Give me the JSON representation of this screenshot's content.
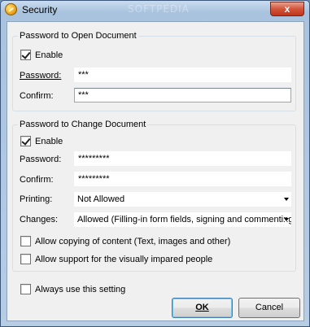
{
  "window": {
    "title": "Security",
    "watermark": "SOFTPEDIA",
    "close_label": "x"
  },
  "open_group": {
    "legend": "Password to Open Document",
    "enable_label": "Enable",
    "enable_checked": true,
    "password_label": "Password:",
    "password_value": "***",
    "confirm_label": "Confirm:",
    "confirm_value": "***"
  },
  "change_group": {
    "legend": "Password to Change Document",
    "enable_label": "Enable",
    "enable_checked": true,
    "password_label": "Password:",
    "password_value": "*********",
    "confirm_label": "Confirm:",
    "confirm_value": "*********",
    "printing_label": "Printing:",
    "printing_value": "Not Allowed",
    "changes_label": "Changes:",
    "changes_value": "Allowed (Filling-in form fields, signing and commenting)",
    "copy_label": "Allow copying of content (Text, images and other)",
    "copy_checked": false,
    "impaired_label": "Allow support for the visually impared people",
    "impaired_checked": false
  },
  "always_label": "Always use this setting",
  "always_checked": false,
  "buttons": {
    "ok": "OK",
    "cancel": "Cancel"
  }
}
